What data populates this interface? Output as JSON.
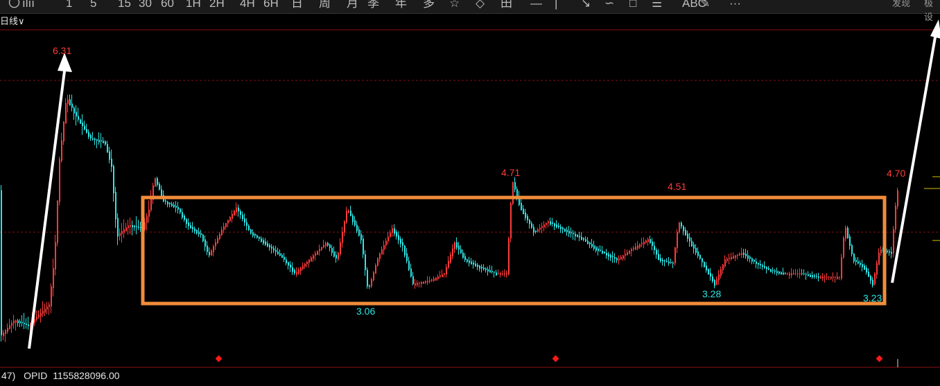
{
  "toolbar": {
    "icons": [
      "circle-icon",
      "bars-icon",
      "minute-icon",
      "min5-icon",
      "min15-icon",
      "min30-icon",
      "min60-icon",
      "min120-icon",
      "min240-icon",
      "min360-icon",
      "day-icon",
      "week-icon",
      "month-icon",
      "quarter-icon",
      "year-icon",
      "multi-icon",
      "pen-icon",
      "diamond-icon",
      "grid-icon",
      "hline-icon",
      "vline-icon",
      "arrow-icon",
      "wave-icon",
      "rect-icon",
      "text-icon",
      "abc-icon",
      "brush-icon",
      "more-icon"
    ],
    "labels": [
      "〇",
      "ılıı",
      "1",
      "5",
      "15",
      "30",
      "60",
      "1H",
      "2H",
      "4H",
      "6H",
      "日",
      "周",
      "月",
      "季",
      "年",
      "多",
      "☆",
      "◇",
      "田",
      "—",
      "|",
      "↘",
      "∽",
      "□",
      "☰",
      "ABC",
      "✎",
      "···"
    ],
    "right_label_1": "发现",
    "right_label_2": "极设"
  },
  "period_label": "日线",
  "bottom": {
    "prefix": "47)",
    "indicator_name": "OPID",
    "indicator_value": "1155828096.00"
  },
  "price_labels": {
    "high_1": "6.31",
    "peak_2": "4.71",
    "peak_3": "4.51",
    "peak_4": "4.70",
    "low_1": "3.06",
    "low_2": "3.28",
    "low_3": "3.23"
  },
  "colors": {
    "up": "#ff3b3b",
    "down": "#2ee6e6",
    "box": "#f28c3b",
    "arrow": "#ffffff",
    "grid": "#8b0f0f",
    "marker": "#ff1a1a"
  }
}
